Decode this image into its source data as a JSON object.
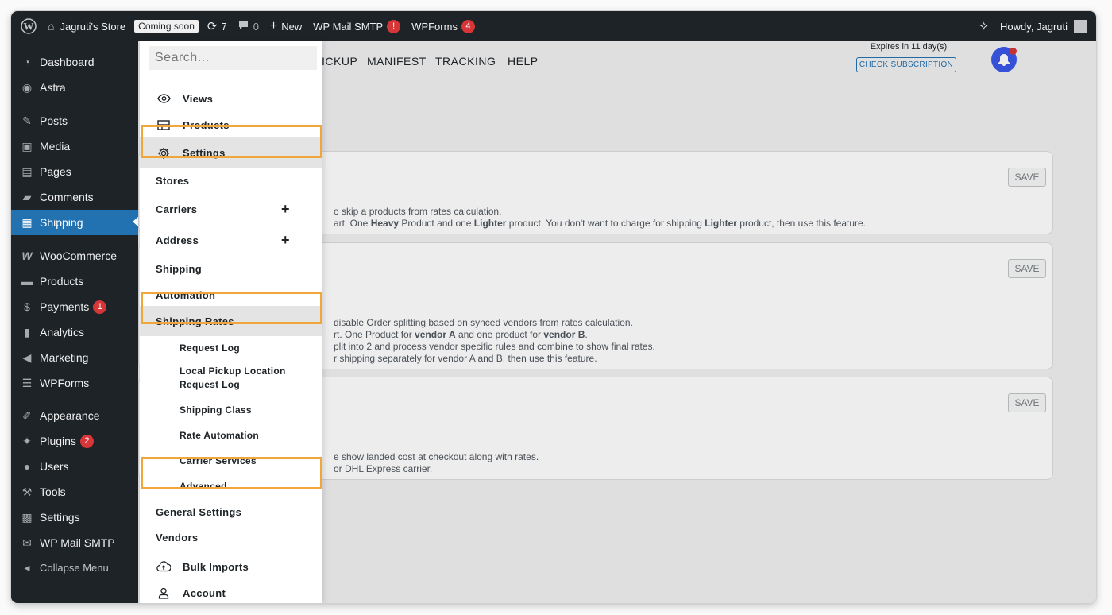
{
  "adminbar": {
    "site_name": "Jagruti's Store",
    "coming_soon": "Coming soon",
    "updates_count": "7",
    "comments_count": "0",
    "new_label": "New",
    "mail_smtp": "WP Mail SMTP",
    "mail_smtp_badge": "!",
    "wpforms": "WPForms",
    "wpforms_badge": "4",
    "howdy": "Howdy, Jagruti"
  },
  "sidebar": {
    "items": [
      {
        "label": "Dashboard"
      },
      {
        "label": "Astra"
      },
      {
        "label": "Posts"
      },
      {
        "label": "Media"
      },
      {
        "label": "Pages"
      },
      {
        "label": "Comments"
      },
      {
        "label": "Shipping"
      },
      {
        "label": "WooCommerce"
      },
      {
        "label": "Products"
      },
      {
        "label": "Payments",
        "badge": "1"
      },
      {
        "label": "Analytics"
      },
      {
        "label": "Marketing"
      },
      {
        "label": "WPForms"
      },
      {
        "label": "Appearance"
      },
      {
        "label": "Plugins",
        "badge": "2"
      },
      {
        "label": "Users"
      },
      {
        "label": "Tools"
      },
      {
        "label": "Settings"
      },
      {
        "label": "WP Mail SMTP"
      },
      {
        "label": "Collapse Menu"
      }
    ]
  },
  "topnav": {
    "tabs": [
      "ICKUP",
      "MANIFEST",
      "TRACKING",
      "HELP"
    ],
    "expires": "Expires in 11 day(s)",
    "check_subscription": "CHECK SUBSCRIPTION"
  },
  "cards": [
    {
      "save": "SAVE",
      "line1": "o skip a products from rates calculation.",
      "line2_a": "art. One ",
      "line2_b": "Heavy",
      "line2_c": " Product and one ",
      "line2_d": "Lighter",
      "line2_e": " product. You don't want to charge for shipping ",
      "line2_f": "Lighter",
      "line2_g": " product, then use this feature."
    },
    {
      "save": "SAVE",
      "line1": "disable Order splitting based on synced vendors from rates calculation.",
      "line2_a": "rt. One Product for ",
      "line2_b": "vendor A",
      "line2_c": " and one product for ",
      "line2_d": "vendor B",
      "line2_e": ".",
      "line3": "plit into 2 and process vendor specific rules and combine to show final rates.",
      "line4": "r shipping separately for vendor A and B, then use this feature."
    },
    {
      "save": "SAVE",
      "line1": "e show landed cost at checkout along with rates.",
      "line2": "or DHL Express carrier."
    }
  ],
  "dropdown": {
    "search_placeholder": "Search...",
    "views": "Views",
    "products": "Products",
    "settings": "Settings",
    "stores": "Stores",
    "carriers": "Carriers",
    "address": "Address",
    "shipping": "Shipping",
    "automation": "Automation",
    "shipping_rates": "Shipping Rates",
    "request_log": "Request Log",
    "local_pickup_1": "Local Pickup Location",
    "local_pickup_2": "Request Log",
    "shipping_class": "Shipping Class",
    "rate_automation": "Rate Automation",
    "carrier_services": "Carrier Services",
    "advanced": "Advanced",
    "general_settings": "General Settings",
    "vendors": "Vendors",
    "bulk_imports": "Bulk Imports",
    "account": "Account",
    "plus": "+"
  },
  "colors": {
    "admin_dark": "#1d2327",
    "active_blue": "#2271b1",
    "highlight_orange": "#f0a63b",
    "badge_red": "#d63638"
  }
}
